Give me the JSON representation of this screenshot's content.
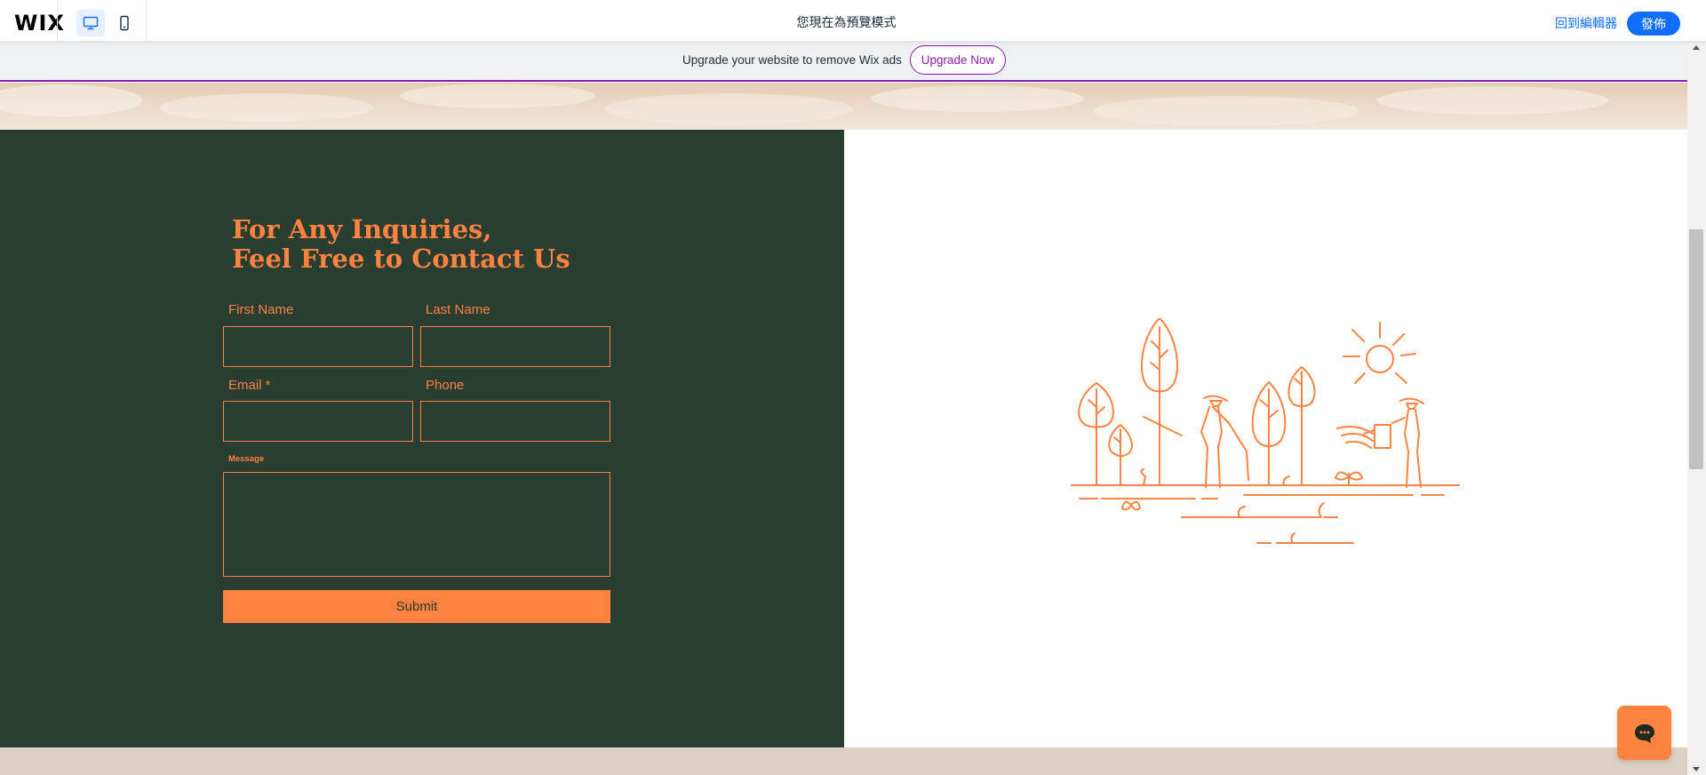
{
  "topbar": {
    "logo": "WIX",
    "desktop_icon": "desktop-monitor-icon",
    "mobile_icon": "mobile-phone-icon",
    "preview_mode_text": "您現在為預覽模式",
    "back_to_editor": "回到編輯器",
    "publish": "發佈",
    "accent_color": "#116dff"
  },
  "ad_banner": {
    "text": "Upgrade your website to remove Wix ads",
    "button": "Upgrade Now",
    "accent_color": "#8c1aa8"
  },
  "contact": {
    "heading_line1": "For Any Inquiries,",
    "heading_line2": "Feel Free to Contact Us",
    "fields": {
      "first_name": {
        "label": "First Name",
        "value": ""
      },
      "last_name": {
        "label": "Last Name",
        "value": ""
      },
      "email": {
        "label": "Email *",
        "value": ""
      },
      "phone": {
        "label": "Phone",
        "value": ""
      },
      "message": {
        "label": "Message",
        "value": ""
      }
    },
    "submit": "Submit",
    "panel_color": "#2a3d31",
    "accent_color": "#ff8340"
  },
  "illustration": {
    "icon": "gardeners-planting-trees-illustration"
  },
  "chat": {
    "icon": "chat-bubble-icon"
  }
}
